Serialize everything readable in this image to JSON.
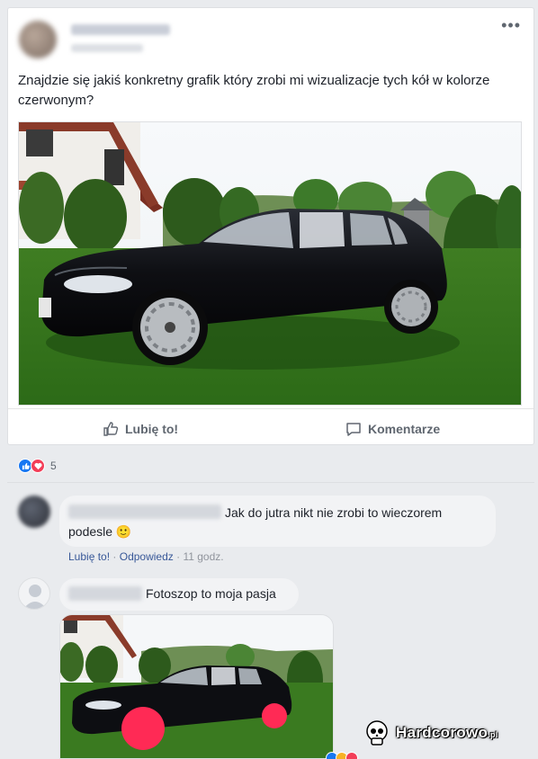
{
  "post": {
    "text": "Znajdzie się jakiś konkretny grafik który zrobi mi wizualizacje tych kół w kolorze czerwonym?",
    "more_label": "•••"
  },
  "actions": {
    "like_label": "Lubię to!",
    "comment_label": "Komentarze"
  },
  "reactions": {
    "count": "5"
  },
  "comments": [
    {
      "text": "Jak do jutra nikt nie zrobi to wieczorem podesle 🙂",
      "meta_like": "Lubię to!",
      "meta_reply": "Odpowiedz",
      "meta_time": "11 godz."
    },
    {
      "text": "Fotoszop to moja pasja"
    }
  ],
  "watermark": {
    "brand": "Hardcorowo",
    "tld": ".pl"
  },
  "colors": {
    "like_blue": "#1877f2",
    "love_red": "#f33e58",
    "link": "#385898",
    "wheel_red": "#ff2a55"
  }
}
